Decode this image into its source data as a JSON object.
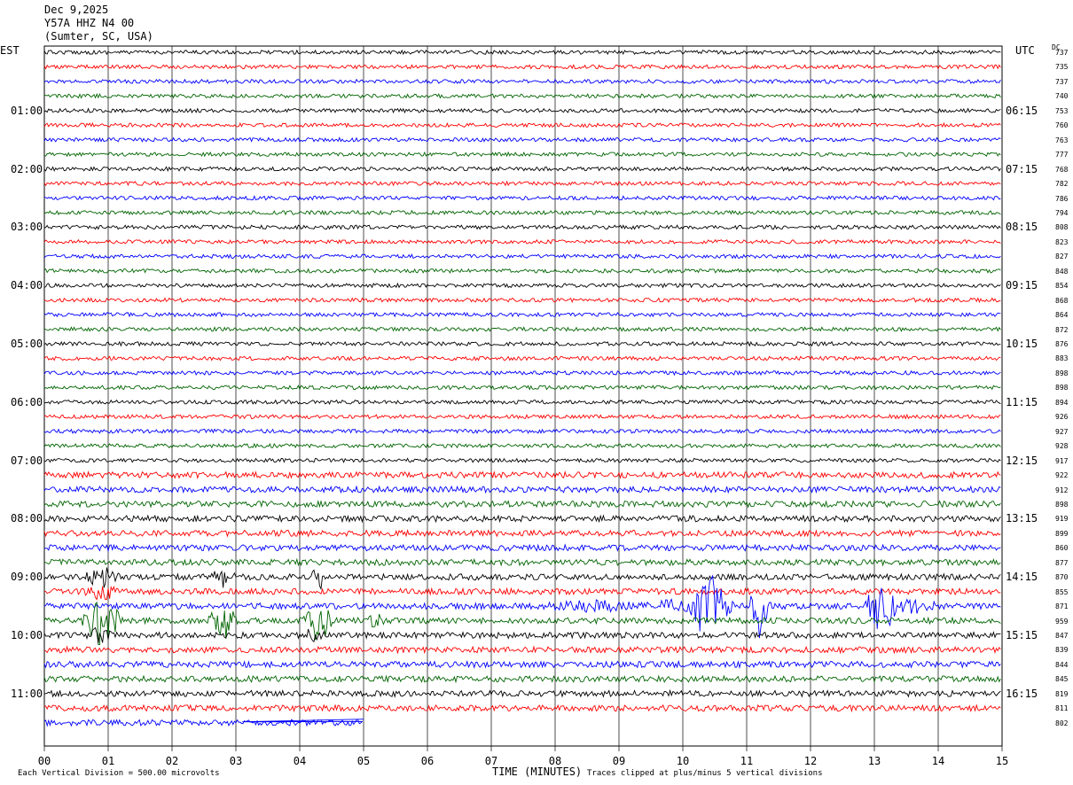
{
  "header": {
    "date": "Dec 9,2025",
    "station": "Y57A HHZ N4 00",
    "location": "(Sumter, SC, USA)"
  },
  "left_zone": "EST",
  "right_zone": "UTC",
  "dc_label": "DC",
  "chart_data": {
    "type": "line",
    "title": "",
    "xlabel": "TIME (MINUTES)",
    "xlim": [
      0,
      15
    ],
    "x_ticks": [
      "00",
      "01",
      "02",
      "03",
      "04",
      "05",
      "06",
      "07",
      "08",
      "09",
      "10",
      "11",
      "12",
      "13",
      "14",
      "15"
    ],
    "left_hour_labels": [
      "01:00",
      "02:00",
      "03:00",
      "04:00",
      "05:00",
      "06:00",
      "07:00",
      "08:00",
      "09:00",
      "10:00",
      "11:00"
    ],
    "right_hour_labels": [
      "06:15",
      "07:15",
      "08:15",
      "09:15",
      "10:15",
      "11:15",
      "12:15",
      "13:15",
      "14:15",
      "15:15",
      "16:15"
    ],
    "trace_colors": [
      "#000000",
      "#ff0000",
      "#0000ff",
      "#006400"
    ],
    "dc_offsets": [
      "737",
      "735",
      "737",
      "740",
      "753",
      "760",
      "763",
      "777",
      "768",
      "782",
      "786",
      "794",
      "808",
      "823",
      "827",
      "848",
      "854",
      "868",
      "864",
      "872",
      "876",
      "883",
      "898",
      "898",
      "894",
      "926",
      "927",
      "928",
      "917",
      "922",
      "912",
      "898",
      "919",
      "899",
      "860",
      "877",
      "870",
      "855",
      "871",
      "959",
      "847",
      "839",
      "844",
      "845",
      "819",
      "811",
      "802"
    ],
    "last_trace_end_minute": 5,
    "scale_note": "Each Vertical Division = 500.00 microvolts",
    "clip_note": "Traces clipped at plus/minus 5 vertical divisions"
  }
}
